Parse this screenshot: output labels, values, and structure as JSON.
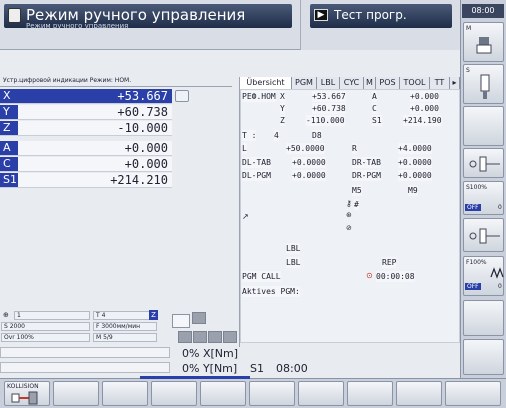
{
  "header": {
    "mode_title": "Режим ручного управления",
    "mode_sub": "Режим ручного управления",
    "program_mode": "Тест прогр.",
    "clock": "08:00"
  },
  "position_display": {
    "title": "Устр.цифровой индикации Режим: НОМ.",
    "axes": [
      {
        "name": "X",
        "value": "+53.667",
        "style": "sel"
      },
      {
        "name": "Y",
        "value": "+60.738",
        "style": "plain"
      },
      {
        "name": "Z",
        "value": "-10.000",
        "style": "plain"
      },
      {
        "name": "A",
        "value": "+0.000",
        "style": "blue"
      },
      {
        "name": "C",
        "value": "+0.000",
        "style": "blue"
      },
      {
        "name": "S1",
        "value": "+214.210",
        "style": "blue"
      }
    ]
  },
  "status": {
    "spindle_axis": "1",
    "tool": "T 4",
    "tool_axis": "Z",
    "speed": "S 2000",
    "feed": "F 3000мм/мин",
    "override": "Ovr 100%",
    "mfunc": "M 5/9"
  },
  "tabs": [
    "Übersicht",
    "PGM",
    "LBL",
    "CYC",
    "M",
    "POS",
    "TOOL",
    "TT"
  ],
  "overview": {
    "ref_label": "РЕФ.НОМ",
    "xyz": [
      {
        "axis": "X",
        "value": "+53.667",
        "axis2": "A",
        "value2": "+0.000"
      },
      {
        "axis": "Y",
        "value": "+60.738",
        "axis2": "C",
        "value2": "+0.000"
      },
      {
        "axis": "Z",
        "value": "-110.000",
        "axis2": "S1",
        "value2": "+214.190"
      }
    ],
    "t_label": "T :",
    "t_num": "4",
    "t_d": "D8",
    "l_label": "L",
    "l_value": "+50.0000",
    "r_label": "R",
    "r_value": "+4.0000",
    "dl_tab_label": "DL-TAB",
    "dl_tab_value": "+0.0000",
    "dr_tab_label": "DR-TAB",
    "dr_tab_value": "+0.0000",
    "dl_pgm_label": "DL-PGM",
    "dl_pgm_value": "+0.0000",
    "dr_pgm_label": "DR-PGM",
    "dr_pgm_value": "+0.0000",
    "m5": "M5",
    "m9": "M9",
    "hash": "#",
    "lbl1": "LBL",
    "lbl2": "LBL",
    "rep": "REP",
    "pgm_call": "PGM CALL",
    "time": "00:00:08",
    "aktives_pgm": "Aktives PGM:"
  },
  "load": {
    "x_pct": "0% X[Nm]",
    "y_pct": "0% Y[Nm]",
    "s1_label": "S1",
    "s1_time": "08:00"
  },
  "right_softkeys": {
    "m_label": "M",
    "s_label": "S",
    "s100": "S100%",
    "f100": "F100%",
    "off1": "OFF",
    "off2": "OFF",
    "zero1": "0",
    "zero2": "0"
  },
  "softkeys": {
    "kollision": "KOLLISION"
  },
  "colors": {
    "accent_blue": "#2b3fa8",
    "bar_dark": "#1f2d48",
    "panel_bg": "#e8ebf0"
  }
}
